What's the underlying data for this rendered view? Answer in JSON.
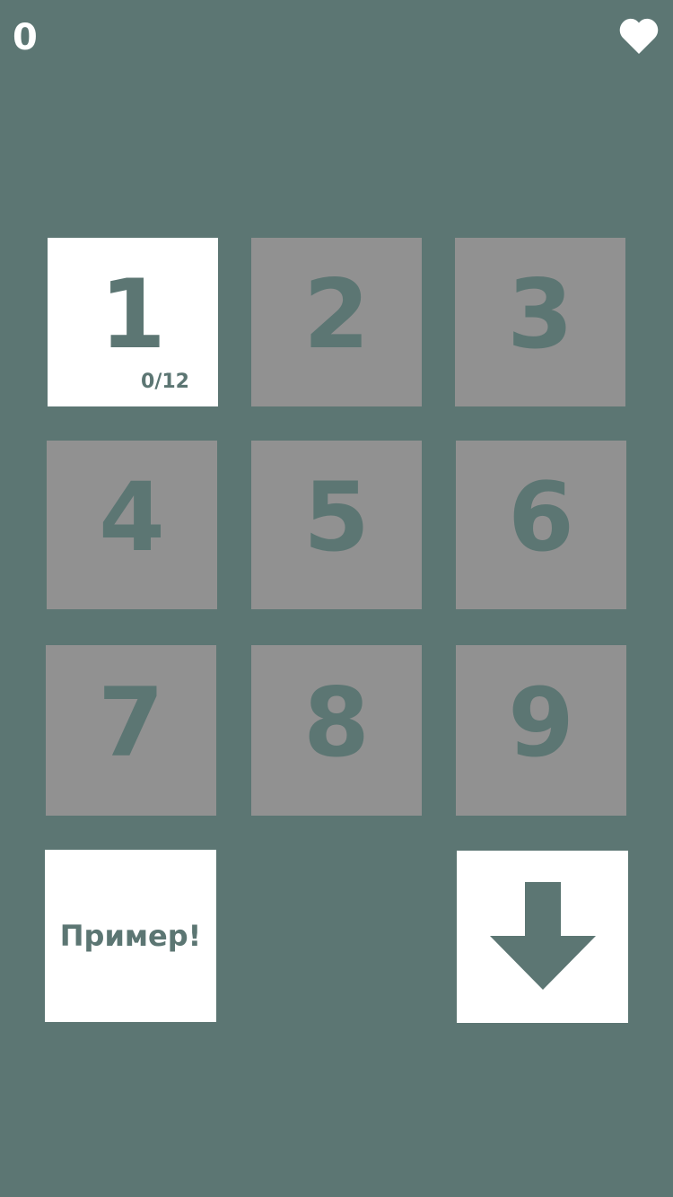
{
  "score": "0",
  "icons": {
    "lives": "heart-icon",
    "next": "arrow-down-icon"
  },
  "colors": {
    "background": "#5c7673",
    "tile_locked": "#919191",
    "tile_active": "#ffffff",
    "tile_text": "#5c7673",
    "header_text": "#ffffff"
  },
  "levels": [
    {
      "number": "1",
      "progress": "0/12",
      "active": true
    },
    {
      "number": "2",
      "active": false
    },
    {
      "number": "3",
      "active": false
    },
    {
      "number": "4",
      "active": false
    },
    {
      "number": "5",
      "active": false
    },
    {
      "number": "6",
      "active": false
    },
    {
      "number": "7",
      "active": false
    },
    {
      "number": "8",
      "active": false
    },
    {
      "number": "9",
      "active": false
    }
  ],
  "example_button": {
    "label": "Пример!"
  }
}
